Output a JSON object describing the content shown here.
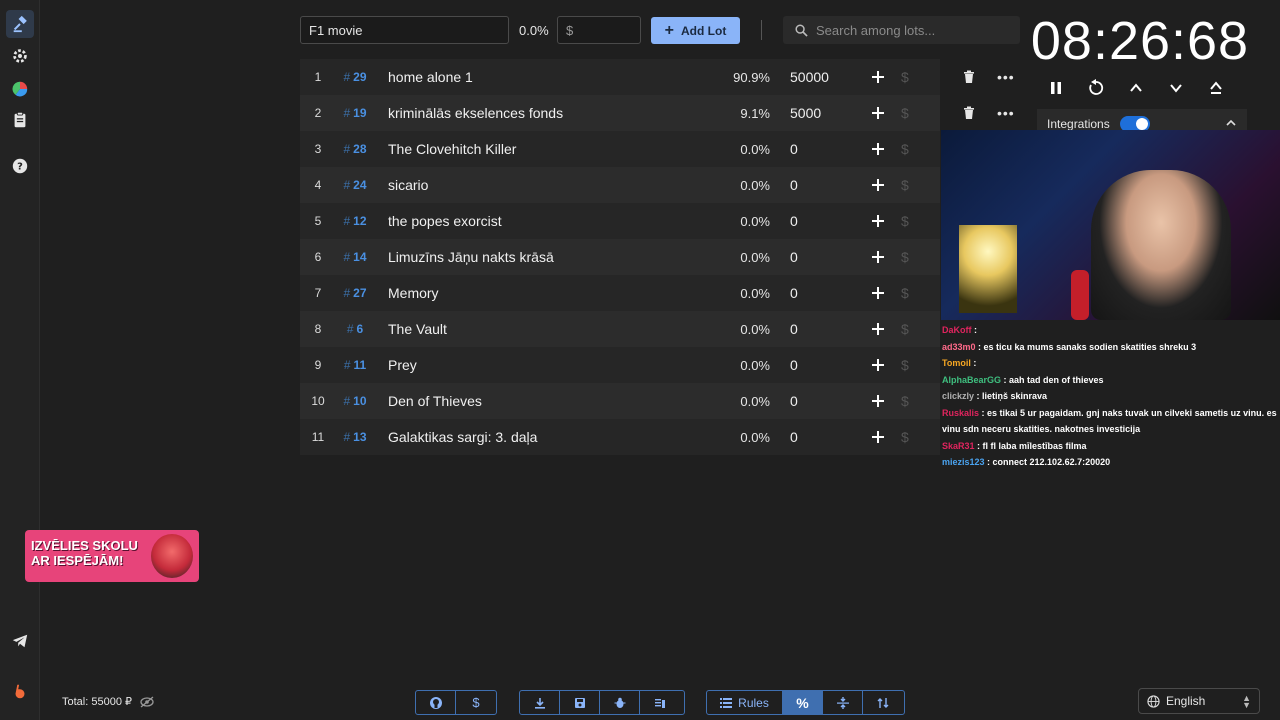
{
  "sidebar": {
    "items": [
      {
        "name": "auction",
        "icon": "gavel-icon"
      },
      {
        "name": "settings",
        "icon": "gear-icon"
      },
      {
        "name": "wheel",
        "icon": "pie-chart-icon"
      },
      {
        "name": "history",
        "icon": "clipboard-icon"
      },
      {
        "name": "help",
        "icon": "help-circle-icon"
      },
      {
        "name": "telegram",
        "icon": "telegram-icon"
      },
      {
        "name": "boosty",
        "icon": "boosty-icon"
      }
    ]
  },
  "toolbar": {
    "lot_name_value": "F1 movie",
    "percent": "0.0%",
    "amount_placeholder": "$",
    "add_lot_label": "Add Lot",
    "search_placeholder": "Search among lots..."
  },
  "lots": [
    {
      "index": "1",
      "id": "29",
      "name": "home alone 1",
      "percent": "90.9%",
      "amount": "50000",
      "deletable": true
    },
    {
      "index": "2",
      "id": "19",
      "name": "kriminālās ekselences fonds",
      "percent": "9.1%",
      "amount": "5000",
      "deletable": true
    },
    {
      "index": "3",
      "id": "28",
      "name": "The Clovehitch Killer",
      "percent": "0.0%",
      "amount": "0"
    },
    {
      "index": "4",
      "id": "24",
      "name": "sicario",
      "percent": "0.0%",
      "amount": "0"
    },
    {
      "index": "5",
      "id": "12",
      "name": "the popes exorcist",
      "percent": "0.0%",
      "amount": "0"
    },
    {
      "index": "6",
      "id": "14",
      "name": "Limuzīns Jāņu nakts krāsā",
      "percent": "0.0%",
      "amount": "0"
    },
    {
      "index": "7",
      "id": "27",
      "name": "Memory",
      "percent": "0.0%",
      "amount": "0"
    },
    {
      "index": "8",
      "id": "6",
      "name": "The Vault",
      "percent": "0.0%",
      "amount": "0"
    },
    {
      "index": "9",
      "id": "11",
      "name": "Prey",
      "percent": "0.0%",
      "amount": "0"
    },
    {
      "index": "10",
      "id": "10",
      "name": "Den of Thieves",
      "percent": "0.0%",
      "amount": "0"
    },
    {
      "index": "11",
      "id": "13",
      "name": "Galaktikas sargi: 3. daļa",
      "percent": "0.0%",
      "amount": "0"
    }
  ],
  "timer": {
    "display": "08:26:68",
    "controls": [
      "pause-icon",
      "restart-icon",
      "chevron-up-icon",
      "chevron-down-icon",
      "eject-icon"
    ]
  },
  "integrations": {
    "label": "Integrations",
    "enabled": true
  },
  "chat": [
    {
      "user": "DaKoff",
      "text": "",
      "color": "#e0245e"
    },
    {
      "user": "ad33m0",
      "text": "es ticu ka mums sanaks sodien skatities shreku 3",
      "color": "#ff6a8a"
    },
    {
      "user": "Tomoil",
      "text": "",
      "color": "#f5a623"
    },
    {
      "user": "AlphaBearGG",
      "text": "aah tad den of thieves",
      "color": "#3fbf7f"
    },
    {
      "user": "clickzly",
      "text": "lietiņš skinrava",
      "color": "#b0b0b0"
    },
    {
      "user": "Ruskalis",
      "text": "es tikai 5 ur pagaidam. gnj naks tuvak un cilveki sametis uz vinu. es vinu sdn neceru skatities. nakotnes investicija",
      "color": "#e0245e"
    },
    {
      "user": "SkaR31",
      "text": "fl fl laba mīlestības filma",
      "color": "#e0245e"
    },
    {
      "user": "miezis123",
      "text": "connect 212.102.62.7:20020",
      "color": "#4aa3f0"
    }
  ],
  "promo": {
    "line1": "IZVĒLIES SKOLU",
    "line2": "AR IESPĒJĀM!"
  },
  "footer": {
    "total": "Total: 55000 ₽",
    "group1": [
      "github-icon",
      "dollar-icon"
    ],
    "group2": [
      "download-icon",
      "save-icon",
      "bug-icon",
      "clear-list-icon"
    ],
    "rules_label": "Rules",
    "language": "English"
  },
  "colors": {
    "accent": "#8ab4f8",
    "id_blue": "#4a90e2",
    "background": "#1f1f1f"
  }
}
